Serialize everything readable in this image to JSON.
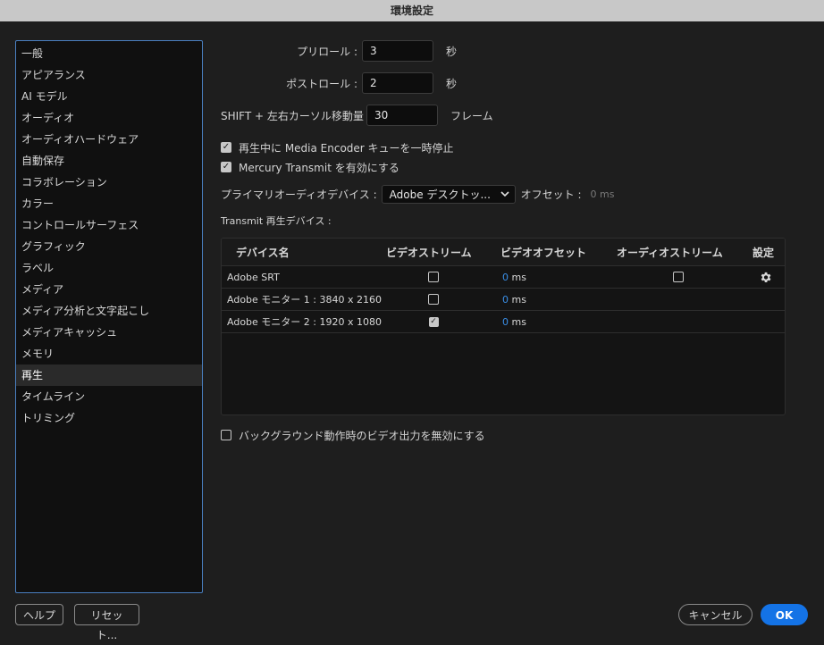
{
  "window": {
    "title": "環境設定"
  },
  "sidebar": {
    "items": [
      {
        "label": "一般"
      },
      {
        "label": "アピアランス"
      },
      {
        "label": "AI モデル"
      },
      {
        "label": "オーディオ"
      },
      {
        "label": "オーディオハードウェア"
      },
      {
        "label": "自動保存"
      },
      {
        "label": "コラボレーション"
      },
      {
        "label": "カラー"
      },
      {
        "label": "コントロールサーフェス"
      },
      {
        "label": "グラフィック"
      },
      {
        "label": "ラベル"
      },
      {
        "label": "メディア"
      },
      {
        "label": "メディア分析と文字起こし"
      },
      {
        "label": "メディアキャッシュ"
      },
      {
        "label": "メモリ"
      },
      {
        "label": "再生",
        "selected": true
      },
      {
        "label": "タイムライン"
      },
      {
        "label": "トリミング"
      }
    ]
  },
  "playback": {
    "preroll": {
      "label": "プリロール :",
      "value": "3",
      "unit": "秒"
    },
    "postroll": {
      "label": "ポストロール :",
      "value": "2",
      "unit": "秒"
    },
    "shift": {
      "label": "SHIFT + 左右カーソル移動量 :",
      "value": "30",
      "unit": "フレーム"
    },
    "pause_encoder": {
      "label": "再生中に Media Encoder キューを一時停止",
      "checked": true
    },
    "mercury": {
      "label": "Mercury Transmit を有効にする",
      "checked": true
    },
    "primary_audio": {
      "label": "プライマリオーディオデバイス :",
      "value": "Adobe デスクトッ...",
      "offset_label": "オフセット :",
      "offset_value": "0 ms"
    },
    "transmit_label": "Transmit 再生デバイス :",
    "table": {
      "headers": {
        "name": "デバイス名",
        "video_stream": "ビデオストリーム",
        "video_offset": "ビデオオフセット",
        "audio_stream": "オーディオストリーム",
        "settings": "設定"
      },
      "rows": [
        {
          "name": "Adobe SRT",
          "video_stream": false,
          "offset_value": "0",
          "offset_unit": "ms",
          "audio_stream": false,
          "has_settings": true
        },
        {
          "name": "Adobe モニター 1 : 3840 x 2160",
          "video_stream": false,
          "offset_value": "0",
          "offset_unit": "ms"
        },
        {
          "name": "Adobe モニター 2 : 1920 x 1080",
          "video_stream": true,
          "offset_value": "0",
          "offset_unit": "ms"
        }
      ]
    },
    "background_disable": {
      "label": "バックグラウンド動作時のビデオ出力を無効にする",
      "checked": false
    }
  },
  "footer": {
    "help": "ヘルプ",
    "reset": "リセット...",
    "cancel": "キャンセル",
    "ok": "OK"
  },
  "colors": {
    "accent": "#1473e6",
    "selection_border": "#4a7fc0",
    "offset_value": "#3a8fe8"
  }
}
